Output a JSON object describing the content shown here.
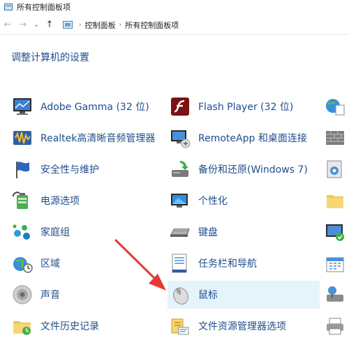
{
  "window": {
    "title": "所有控制面板项"
  },
  "address": {
    "crumbs": [
      "控制面板",
      "所有控制面板项"
    ],
    "sep": "›"
  },
  "nav": {
    "back": "←",
    "forward": "→",
    "recent": "⌄",
    "up": "↑"
  },
  "heading": "调整计算机的设置",
  "items": {
    "c1": [
      "Adobe Gamma (32 位)",
      "Realtek高清晰音频管理器",
      "安全性与维护",
      "电源选项",
      "家庭组",
      "区域",
      "声音",
      "文件历史记录"
    ],
    "c2": [
      "Flash Player (32 位)",
      "RemoteApp 和桌面连接",
      "备份和还原(Windows 7)",
      "个性化",
      "键盘",
      "任务栏和导航",
      "鼠标",
      "文件资源管理器选项"
    ]
  },
  "colors": {
    "link": "#1e4e8c",
    "selected": "#e5f3fb",
    "arrow": "#e53935"
  }
}
